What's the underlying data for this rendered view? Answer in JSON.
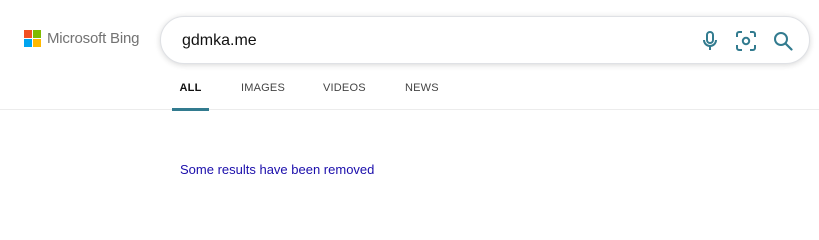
{
  "brand": {
    "name": "Microsoft Bing",
    "logo_colors": [
      "#f25022",
      "#7fba00",
      "#00a4ef",
      "#ffb900"
    ]
  },
  "search": {
    "query": "gdmka.me",
    "icons": [
      "microphone-icon",
      "visual-search-icon",
      "search-icon"
    ],
    "icon_color": "#327b8f"
  },
  "tabs": [
    {
      "label": "ALL",
      "active": true
    },
    {
      "label": "IMAGES",
      "active": false
    },
    {
      "label": "VIDEOS",
      "active": false
    },
    {
      "label": "NEWS",
      "active": false
    }
  ],
  "results": {
    "notice": "Some results have been removed"
  }
}
